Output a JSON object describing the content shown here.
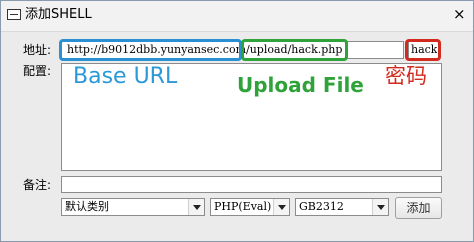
{
  "window": {
    "title": "添加SHELL",
    "close_glyph": "×",
    "system_icon": "window-menu-icon"
  },
  "form": {
    "address_label": "地址:",
    "url_value": "http://b9012dbb.yunyansec.com/upload/hack.php",
    "password_value": "hack",
    "config_label": "配置:",
    "config_value": "",
    "note_label": "备注:",
    "note_value": "",
    "category_selected": "默认类别",
    "type_selected": "PHP(Eval)",
    "encoding_selected": "GB2312",
    "add_button": "添加"
  },
  "annotations": {
    "base_url": "Base URL",
    "upload_file": "Upload File",
    "password": "密码",
    "colors": {
      "blue": "#2b8fd3",
      "green": "#2fa33a",
      "red": "#d22a1f"
    }
  }
}
